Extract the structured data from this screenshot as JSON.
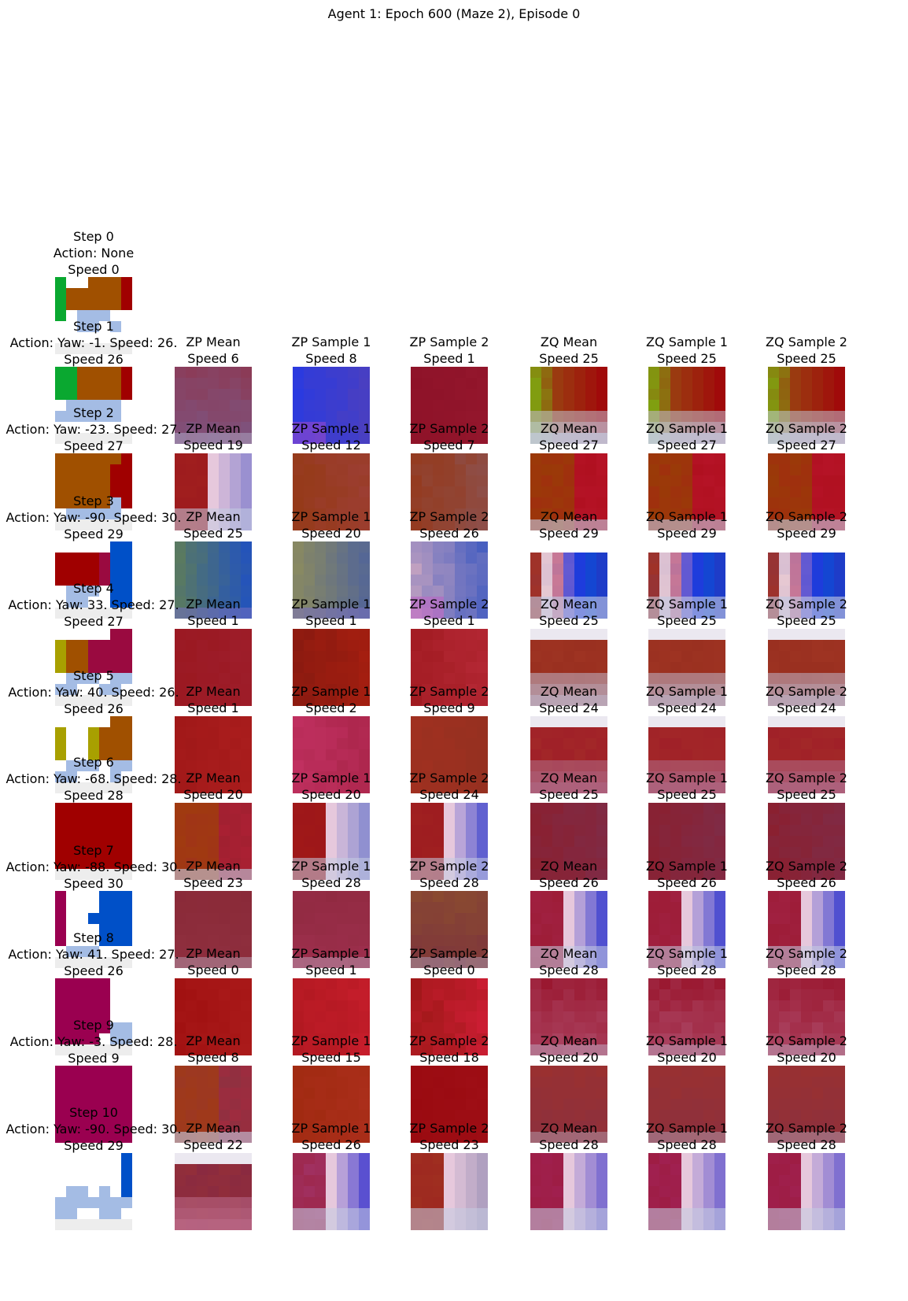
{
  "figure": {
    "title": "Agent 1: Epoch 600 (Maze 2), Episode 0"
  },
  "column_titles": [
    "ZP Mean",
    "ZP Sample 1",
    "ZP Sample 2",
    "ZQ Mean",
    "ZQ Sample 1",
    "ZQ Sample 2"
  ],
  "steps": [
    {
      "title": "Step 0",
      "action": "Action: None",
      "speed": "Speed 0",
      "panels": []
    },
    {
      "title": "Step 1",
      "action": "Action: Yaw: -1. Speed: 26.",
      "speed": "Speed 26",
      "panels": [
        {
          "speed": "Speed 6",
          "base": "#8c3a55",
          "accent": "#7a5a8a",
          "style": "mean"
        },
        {
          "speed": "Speed 8",
          "base": "#4a3fc0",
          "accent": "#2a3ae0",
          "style": "blue"
        },
        {
          "speed": "Speed 1",
          "base": "#8e1228",
          "accent": "#96182e",
          "style": "flat"
        },
        {
          "speed": "Speed 25",
          "base": "#9a3a10",
          "accent": "#80a010",
          "style": "greenred"
        },
        {
          "speed": "Speed 25",
          "base": "#9a3a10",
          "accent": "#80a010",
          "style": "greenred"
        },
        {
          "speed": "Speed 25",
          "base": "#9a3a10",
          "accent": "#80a010",
          "style": "greenred"
        }
      ]
    },
    {
      "title": "Step 2",
      "action": "Action: Yaw: -23. Speed: 27.",
      "speed": "Speed 27",
      "panels": [
        {
          "speed": "Speed 19",
          "base": "#a01e1e",
          "accent": "#9a90d0",
          "style": "redlight"
        },
        {
          "speed": "Speed 12",
          "base": "#953a18",
          "accent": "#a04040",
          "style": "flat"
        },
        {
          "speed": "Speed 7",
          "base": "#95381a",
          "accent": "#8a5a60",
          "style": "flat"
        },
        {
          "speed": "Speed 27",
          "base": "#9a3a08",
          "accent": "#b01020",
          "style": "orangered"
        },
        {
          "speed": "Speed 27",
          "base": "#9a3a08",
          "accent": "#b01020",
          "style": "orangered"
        },
        {
          "speed": "Speed 27",
          "base": "#9a3a08",
          "accent": "#b01020",
          "style": "orangered"
        }
      ]
    },
    {
      "title": "Step 3",
      "action": "Action: Yaw: -90. Speed: 30.",
      "speed": "Speed 29",
      "panels": [
        {
          "speed": "Speed 25",
          "base": "#2a58b0",
          "accent": "#5a7a60",
          "style": "bluegreen"
        },
        {
          "speed": "Speed 20",
          "base": "#5a6a90",
          "accent": "#8a8a60",
          "style": "bluegreen"
        },
        {
          "speed": "Speed 26",
          "base": "#4a60c0",
          "accent": "#c0a0c0",
          "style": "blue"
        },
        {
          "speed": "Speed 29",
          "base": "#1a40d0",
          "accent": "#a03030",
          "style": "stripe"
        },
        {
          "speed": "Speed 29",
          "base": "#1a40d0",
          "accent": "#a03030",
          "style": "stripe"
        },
        {
          "speed": "Speed 29",
          "base": "#1a40d0",
          "accent": "#a03030",
          "style": "stripe"
        }
      ]
    },
    {
      "title": "Step 4",
      "action": "Action: Yaw: 33. Speed: 27.",
      "speed": "Speed 27",
      "panels": [
        {
          "speed": "Speed 1",
          "base": "#9a1820",
          "accent": "#a02030",
          "style": "flat"
        },
        {
          "speed": "Speed 1",
          "base": "#8a1a10",
          "accent": "#b02010",
          "style": "flat"
        },
        {
          "speed": "Speed 1",
          "base": "#a01a20",
          "accent": "#c03040",
          "style": "flat"
        },
        {
          "speed": "Speed 25",
          "base": "#9a3020",
          "accent": "#c0c0d8",
          "style": "band"
        },
        {
          "speed": "Speed 25",
          "base": "#9a3020",
          "accent": "#c0c0d8",
          "style": "band"
        },
        {
          "speed": "Speed 25",
          "base": "#9a3020",
          "accent": "#c0c0d8",
          "style": "band"
        }
      ]
    },
    {
      "title": "Step 5",
      "action": "Action: Yaw: 40. Speed: 26.",
      "speed": "Speed 26",
      "panels": [
        {
          "speed": "Speed 1",
          "base": "#a01818",
          "accent": "#b02020",
          "style": "flat"
        },
        {
          "speed": "Speed 2",
          "base": "#c03060",
          "accent": "#a02040",
          "style": "flat"
        },
        {
          "speed": "Speed 9",
          "base": "#a03020",
          "accent": "#903020",
          "style": "flat"
        },
        {
          "speed": "Speed 24",
          "base": "#a02028",
          "accent": "#b07090",
          "style": "band"
        },
        {
          "speed": "Speed 24",
          "base": "#a02028",
          "accent": "#b07090",
          "style": "band"
        },
        {
          "speed": "Speed 24",
          "base": "#a02028",
          "accent": "#b07090",
          "style": "band"
        }
      ]
    },
    {
      "title": "Step 6",
      "action": "Action: Yaw: -68. Speed: 28.",
      "speed": "Speed 28",
      "panels": [
        {
          "speed": "Speed 20",
          "base": "#a03a10",
          "accent": "#a02030",
          "style": "orangered"
        },
        {
          "speed": "Speed 20",
          "base": "#a01818",
          "accent": "#9090d0",
          "style": "redlight"
        },
        {
          "speed": "Speed 24",
          "base": "#a02020",
          "accent": "#6060d0",
          "style": "redlight"
        },
        {
          "speed": "Speed 25",
          "base": "#8a2030",
          "accent": "#7a3050",
          "style": "flat"
        },
        {
          "speed": "Speed 25",
          "base": "#8a2030",
          "accent": "#7a3050",
          "style": "flat"
        },
        {
          "speed": "Speed 25",
          "base": "#8a2030",
          "accent": "#7a3050",
          "style": "flat"
        }
      ]
    },
    {
      "title": "Step 7",
      "action": "Action: Yaw: -88. Speed: 30.",
      "speed": "Speed 30",
      "panels": [
        {
          "speed": "Speed 23",
          "base": "#8a2a38",
          "accent": "#903040",
          "style": "mean"
        },
        {
          "speed": "Speed 28",
          "base": "#902a40",
          "accent": "#a03050",
          "style": "mean"
        },
        {
          "speed": "Speed 28",
          "base": "#8a4a30",
          "accent": "#7a3040",
          "style": "mean"
        },
        {
          "speed": "Speed 26",
          "base": "#a02040",
          "accent": "#5050d0",
          "style": "redlight"
        },
        {
          "speed": "Speed 26",
          "base": "#a02040",
          "accent": "#5050d0",
          "style": "redlight"
        },
        {
          "speed": "Speed 26",
          "base": "#a02040",
          "accent": "#5050d0",
          "style": "redlight"
        }
      ]
    },
    {
      "title": "Step 8",
      "action": "Action: Yaw: 41. Speed: 27.",
      "speed": "Speed 26",
      "panels": [
        {
          "speed": "Speed 0",
          "base": "#a01010",
          "accent": "#b02020",
          "style": "flat"
        },
        {
          "speed": "Speed 1",
          "base": "#b01820",
          "accent": "#d02030",
          "style": "flat"
        },
        {
          "speed": "Speed 0",
          "base": "#a01818",
          "accent": "#e02040",
          "style": "flat"
        },
        {
          "speed": "Speed 28",
          "base": "#9a1830",
          "accent": "#b05070",
          "style": "mean"
        },
        {
          "speed": "Speed 28",
          "base": "#9a1830",
          "accent": "#b05070",
          "style": "mean"
        },
        {
          "speed": "Speed 28",
          "base": "#9a1830",
          "accent": "#b05070",
          "style": "mean"
        }
      ]
    },
    {
      "title": "Step 9",
      "action": "Action: Yaw: -3. Speed: 28.",
      "speed": "Speed 9",
      "panels": [
        {
          "speed": "Speed 8",
          "base": "#a03a18",
          "accent": "#903040",
          "style": "orangered"
        },
        {
          "speed": "Speed 15",
          "base": "#a02a10",
          "accent": "#b03020",
          "style": "flat"
        },
        {
          "speed": "Speed 18",
          "base": "#9a0a10",
          "accent": "#a01018",
          "style": "flat"
        },
        {
          "speed": "Speed 20",
          "base": "#9a3030",
          "accent": "#8a3040",
          "style": "mean"
        },
        {
          "speed": "Speed 20",
          "base": "#9a3030",
          "accent": "#8a3040",
          "style": "mean"
        },
        {
          "speed": "Speed 20",
          "base": "#9a3030",
          "accent": "#8a3040",
          "style": "mean"
        }
      ]
    },
    {
      "title": "Step 10",
      "action": "Action: Yaw: -90. Speed: 30.",
      "speed": "Speed 29",
      "panels": [
        {
          "speed": "Speed 22",
          "base": "#8a2a40",
          "accent": "#c07090",
          "style": "band"
        },
        {
          "speed": "Speed 26",
          "base": "#a03060",
          "accent": "#5a50d0",
          "style": "redlight"
        },
        {
          "speed": "Speed 23",
          "base": "#a03020",
          "accent": "#b0a0c0",
          "style": "redlight"
        },
        {
          "speed": "Speed 28",
          "base": "#a02050",
          "accent": "#8070d0",
          "style": "redlight"
        },
        {
          "speed": "Speed 28",
          "base": "#a02050",
          "accent": "#8070d0",
          "style": "redlight"
        },
        {
          "speed": "Speed 28",
          "base": "#a02050",
          "accent": "#8070d0",
          "style": "redlight"
        }
      ]
    }
  ]
}
